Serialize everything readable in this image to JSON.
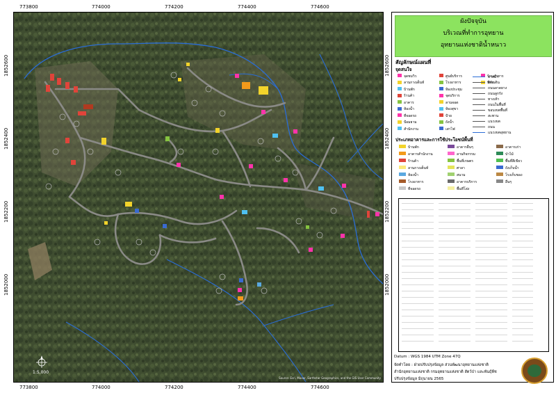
{
  "axes": {
    "x_ticks": [
      "773800",
      "774000",
      "774200",
      "774400",
      "774600"
    ],
    "y_ticks": [
      "1852600",
      "1852400",
      "1852200",
      "1852000"
    ]
  },
  "map": {
    "scale_text": "1:5,000",
    "credit": "Source: Esri, Maxar, Earthstar Geographics, and the GIS User Community"
  },
  "legend": {
    "title_lines": [
      "ผังปัจจุบัน",
      "บริเวณที่ทำการอุทยาน",
      "อุทยานแห่งชาติน้ำหนาว"
    ],
    "symbols_heading": "สัญลักษณ์แผนที่",
    "sub_heading": "จุดสนใจ",
    "poi_items": [
      "จุดชมวิว",
      "ลานกางเต็นท์",
      "บ้านพัก",
      "ร้านค้า",
      "อาคาร",
      "ห้องน้ำ",
      "ที่จอดรถ",
      "ป้อมยาม",
      "สำนักงาน",
      "ศูนย์บริการ",
      "โรงอาหาร",
      "ห้องประชุม",
      "จุดบริการ",
      "ลานจอด",
      "ห้องสุขา",
      "ป้าย",
      "ถังน้ำ",
      "เสาไฟ",
      "ร้านอาหาร",
      "ที่พัก"
    ],
    "line_items": [
      "ทางน้ำ",
      "ทางเดิน",
      "ถนนลาดยาง",
      "ถนนลูกรัง",
      "ทางเท้า",
      "ถนนในพื้นที่",
      "ขอบเขตพื้นที่",
      "สะพาน",
      "แนวเขต",
      "ถนน",
      "แนวเขตอุทยาน"
    ],
    "landuse_heading": "ประเภทอาคารและการใช้ประโยชน์พื้นที่",
    "landuse_items": [
      "บ้านพัก",
      "อาคารสำนักงาน",
      "ร้านค้า",
      "ลานกางเต็นท์",
      "ห้องน้ำ",
      "โรงอาหาร",
      "ที่จอดรถ",
      "อาคารอื่นๆ",
      "ลานกิจกรรม",
      "พื้นที่เกษตร",
      "ศาลา",
      "สนาม",
      "อาคารบริการ",
      "พื้นที่โล่ง",
      "อาคารเก่า",
      "ป่าไม้",
      "พื้นที่สีเขียว",
      "ถังเก็บน้ำ",
      "โรงเก็บของ",
      "อื่นๆ"
    ],
    "landuse_colors": [
      "#f2d32b",
      "#f29a1b",
      "#e0443a",
      "#fce97a",
      "#5aa8e0",
      "#a55b2a",
      "#c8c8c8",
      "#7a4a9a",
      "#ff66cc",
      "#86c440",
      "#e4e45a",
      "#a0d070",
      "#6a6a6a",
      "#f5f0a0",
      "#8a6a4a",
      "#2e8b57",
      "#4fc04f",
      "#3a6ad0",
      "#bb8844",
      "#888888"
    ],
    "datum": "Datum : WGS 1984 UTM Zone 47Q",
    "maker": "จัดทำโดย : ฝ่ายปรับปรุงข้อมูล ส่วนพัฒนาอุทยานแห่งชาติ",
    "office": "สำนักอุทยานแห่งชาติ กรมอุทยานแห่งชาติ สัตว์ป่า และพันธุ์พืช",
    "updated": "ปรับปรุงข้อมูล มิถุนายน 2565"
  },
  "colors": {
    "forest": "#3d4a2e",
    "road": "#8a8a86",
    "stream": "#2a6cd6",
    "title_bg": "#8ce35f"
  }
}
